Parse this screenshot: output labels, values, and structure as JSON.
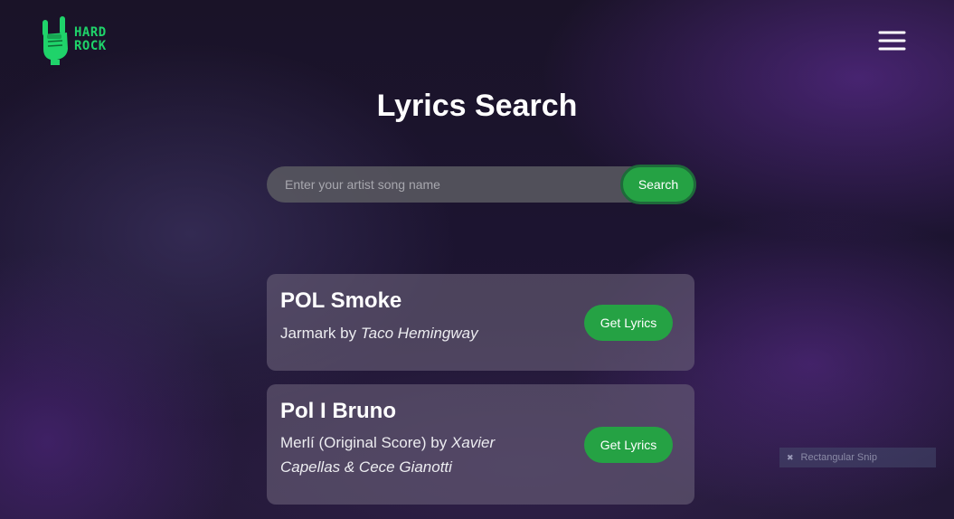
{
  "logo": {
    "line1": "HARD",
    "line2": "ROCK"
  },
  "page_title": "Lyrics Search",
  "search": {
    "placeholder": "Enter your artist song name",
    "value": "",
    "button_label": "Search"
  },
  "results": [
    {
      "title": "POL Smoke",
      "song": "Jarmark",
      "by": "by",
      "artist": "Taco Hemingway",
      "button_label": "Get Lyrics"
    },
    {
      "title": "Pol I Bruno",
      "song": "Merlí (Original Score)",
      "by": "by",
      "artist": "Xavier Capellas & Cece Gianotti",
      "button_label": "Get Lyrics"
    }
  ],
  "snip_overlay": {
    "label": "Rectangular Snip"
  },
  "colors": {
    "accent_green": "#25a244",
    "logo_green": "#1fd36a",
    "background": "#1a1328"
  },
  "icons": {
    "menu": "hamburger-menu-icon",
    "logo": "rock-hand-icon"
  }
}
